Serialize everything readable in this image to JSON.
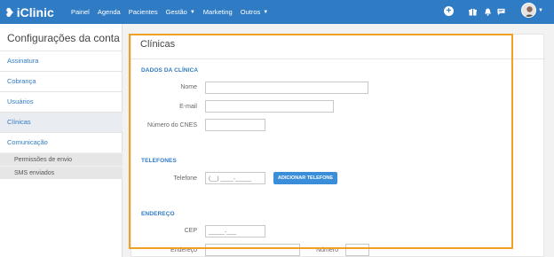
{
  "app": {
    "name": "iClinic"
  },
  "nav": [
    {
      "label": "Painel",
      "has_caret": false
    },
    {
      "label": "Agenda",
      "has_caret": false
    },
    {
      "label": "Pacientes",
      "has_caret": false
    },
    {
      "label": "Gestão",
      "has_caret": true
    },
    {
      "label": "Marketing",
      "has_caret": false
    },
    {
      "label": "Outros",
      "has_caret": true
    }
  ],
  "sidebar": {
    "title": "Configurações da conta",
    "items": [
      {
        "label": "Assinatura"
      },
      {
        "label": "Cobrança"
      },
      {
        "label": "Usuários"
      },
      {
        "label": "Clínicas",
        "active": true
      },
      {
        "label": "Comunicação"
      }
    ],
    "subitems": [
      {
        "label": "Permissões de envio"
      },
      {
        "label": "SMS enviados"
      }
    ]
  },
  "panel": {
    "title": "Clínicas",
    "sections": {
      "clinic": "DADOS DA CLÍNICA",
      "phones": "TELEFONES",
      "address": "ENDEREÇO"
    },
    "fields": {
      "name_label": "Nome",
      "name_value": "",
      "email_label": "E-mail",
      "email_value": "",
      "cnes_label": "Número do CNES",
      "cnes_value": "",
      "phone_label": "Telefone",
      "phone_placeholder": "(__) ____-_____",
      "add_phone_button": "ADICIONAR TELEFONE",
      "cep_label": "CEP",
      "cep_placeholder": "_____-___",
      "address_label": "Endereço",
      "number_label": "Número"
    }
  },
  "colors": {
    "primary": "#2f7bc4",
    "highlight": "#f0a023"
  }
}
